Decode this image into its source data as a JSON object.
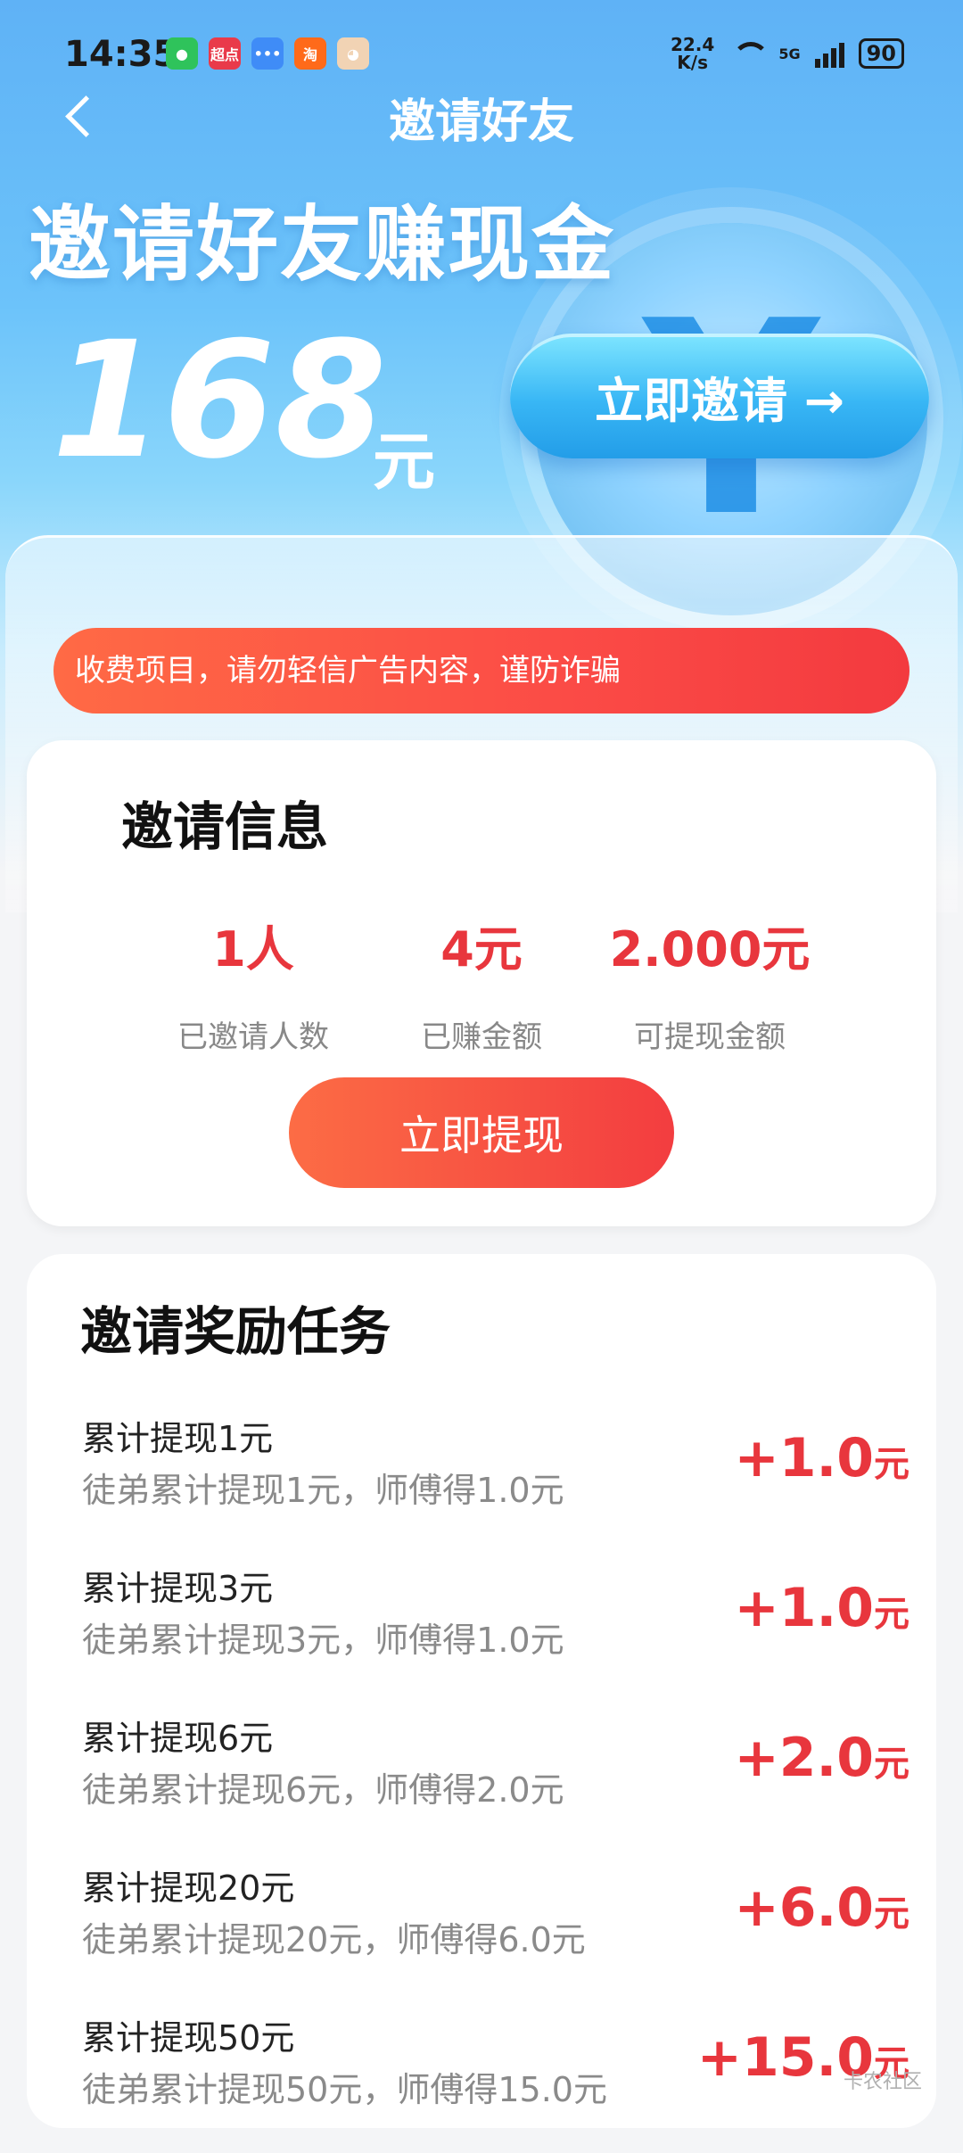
{
  "status": {
    "time": "14:35",
    "apps": [
      "微信",
      "超点",
      "消息",
      "淘",
      "宠"
    ],
    "net_speed": "22.4",
    "net_unit": "K/s",
    "signal": "5G",
    "battery": "90"
  },
  "nav": {
    "title": "邀请好友"
  },
  "hero": {
    "title": "邀请好友赚现金",
    "amount": "168",
    "unit": "元",
    "invite_button": "立即邀请 →"
  },
  "notice": {
    "text": "收费项目，请勿轻信广告内容，谨防诈骗"
  },
  "invite_info": {
    "title": "邀请信息",
    "stats": [
      {
        "value": "1人",
        "label": "已邀请人数"
      },
      {
        "value": "4元",
        "label": "已赚金额"
      },
      {
        "value": "2.000元",
        "label": "可提现金额"
      }
    ],
    "withdraw_button": "立即提现"
  },
  "tasks": {
    "title": "邀请奖励任务",
    "items": [
      {
        "name": "累计提现1元",
        "desc": "徒弟累计提现1元，师傅得1.0元",
        "reward": "+1.0",
        "unit": "元"
      },
      {
        "name": "累计提现3元",
        "desc": "徒弟累计提现3元，师傅得1.0元",
        "reward": "+1.0",
        "unit": "元"
      },
      {
        "name": "累计提现6元",
        "desc": "徒弟累计提现6元，师傅得2.0元",
        "reward": "+2.0",
        "unit": "元"
      },
      {
        "name": "累计提现20元",
        "desc": "徒弟累计提现20元，师傅得6.0元",
        "reward": "+6.0",
        "unit": "元"
      },
      {
        "name": "累计提现50元",
        "desc": "徒弟累计提现50元，师傅得15.0元",
        "reward": "+15.0",
        "unit": "元"
      }
    ]
  },
  "watermark": "卡农社区",
  "colors": {
    "accent_red": "#e8363d",
    "hero_blue": "#5fb2f6"
  }
}
